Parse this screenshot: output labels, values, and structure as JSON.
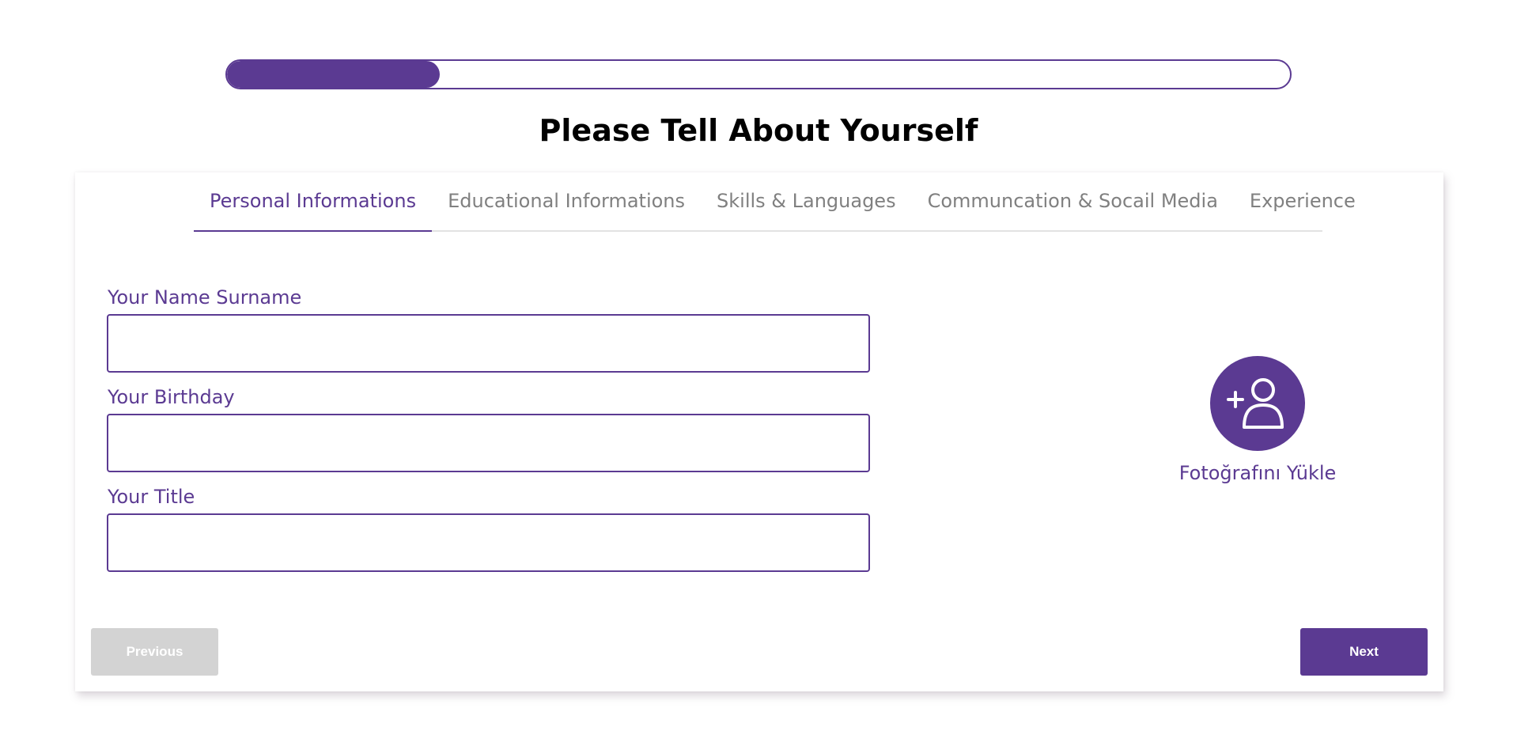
{
  "progress": {
    "value": 0.2
  },
  "page": {
    "title": "Please Tell About Yourself"
  },
  "tabs": [
    {
      "label": "Personal Informations",
      "active": true
    },
    {
      "label": "Educational Informations",
      "active": false
    },
    {
      "label": "Skills & Languages",
      "active": false
    },
    {
      "label": "Communcation & Socail Media",
      "active": false
    },
    {
      "label": "Experience",
      "active": false
    }
  ],
  "form": {
    "name_label": "Your Name Surname",
    "name_value": "",
    "birthday_label": "Your Birthday",
    "birthday_value": "",
    "title_label": "Your Title",
    "title_value": ""
  },
  "photo": {
    "label": "Fotoğrafını Yükle",
    "icon": "add-user-icon"
  },
  "buttons": {
    "previous_label": "Previous",
    "next_label": "Next"
  },
  "colors": {
    "accent": "#5b3a92",
    "inactive_tab": "#808080",
    "disabled_button": "#d3d3d3"
  }
}
